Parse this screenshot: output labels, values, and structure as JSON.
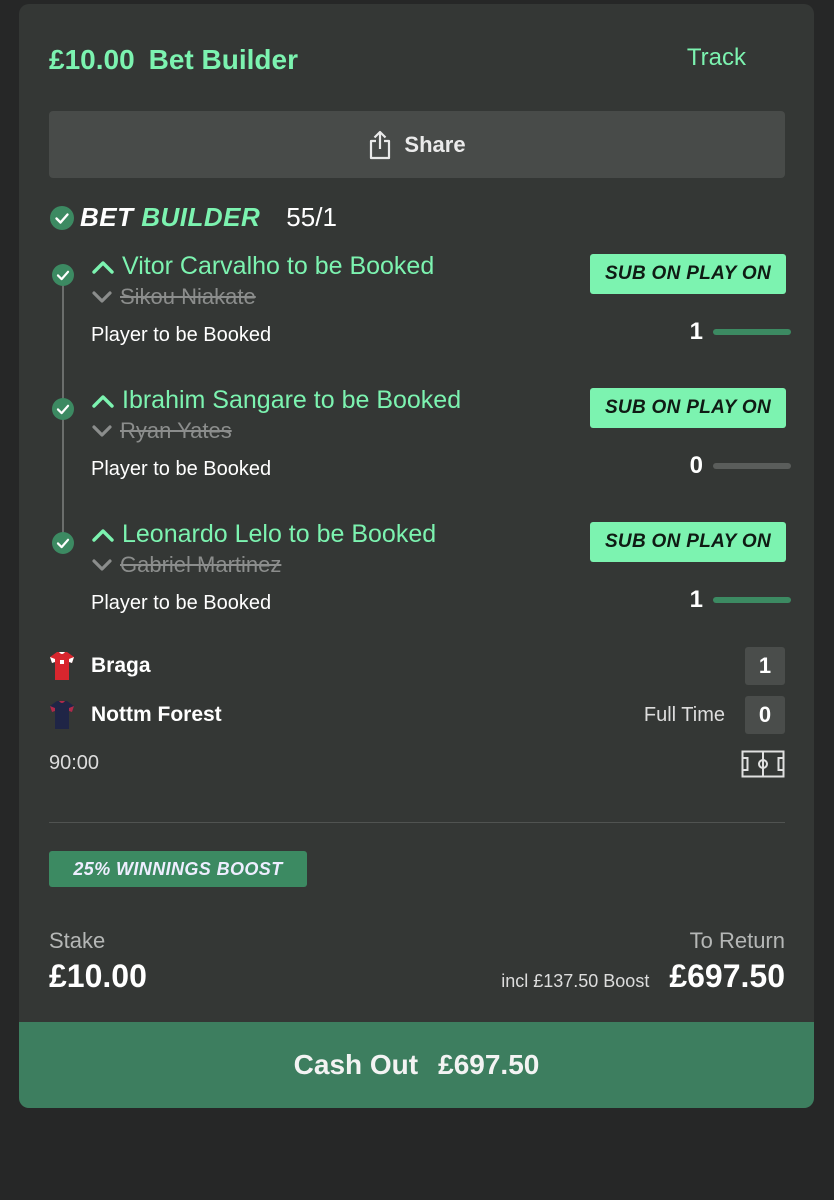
{
  "header": {
    "stake": "£10.00",
    "title": "Bet Builder",
    "track_label": "Track"
  },
  "share": {
    "icon": "share-icon",
    "label": "Share"
  },
  "bet_builder": {
    "label_part1": "BET",
    "label_part2": "BUILDER",
    "odds": "55/1"
  },
  "legs": [
    {
      "selection": "Vitor Carvalho to be Booked",
      "substituted": "Sikou Niakate",
      "market": "Player to be Booked",
      "badge": "SUB ON PLAY ON",
      "count": "1",
      "progress": 1.0
    },
    {
      "selection": "Ibrahim Sangare to be Booked",
      "substituted": "Ryan Yates",
      "market": "Player to be Booked",
      "badge": "SUB ON PLAY ON",
      "count": "0",
      "progress": 0.0
    },
    {
      "selection": "Leonardo Lelo to be Booked",
      "substituted": "Gabriel Martinez",
      "market": "Player to be Booked",
      "badge": "SUB ON PLAY ON",
      "count": "1",
      "progress": 1.0
    }
  ],
  "match": {
    "home": {
      "name": "Braga",
      "score": "1"
    },
    "away": {
      "name": "Nottm Forest",
      "score": "0"
    },
    "status": "Full Time",
    "clock": "90:00"
  },
  "boost_badge": "25% WINNINGS BOOST",
  "stake": {
    "label": "Stake",
    "value": "£10.00"
  },
  "to_return": {
    "label": "To Return",
    "incl": "incl £137.50 Boost",
    "value": "£697.50"
  },
  "cash_out": {
    "label": "Cash Out",
    "value": "£697.50"
  },
  "colors": {
    "accent": "#7cf3b0",
    "cashout": "#3d7e5f",
    "card": "#343735"
  }
}
